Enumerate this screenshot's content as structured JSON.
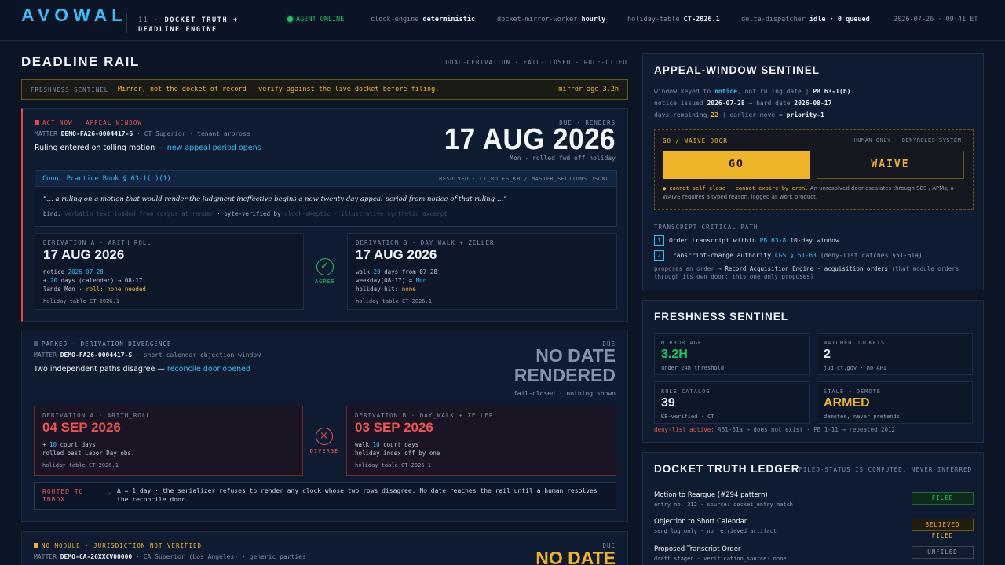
{
  "header": {
    "logo": "AVOWAL",
    "module_num": "11 ·",
    "module_title": "DOCKET TRUTH + DEADLINE ENGINE",
    "agent": "AGENT ONLINE",
    "clock_k": "clock-engine",
    "clock_v": "deterministic",
    "mirror_k": "docket-mirror-worker",
    "mirror_v": "hourly",
    "holiday_k": "holiday-table",
    "holiday_v": "CT-2026.1",
    "delta_k": "delta-dispatcher",
    "delta_v": "idle · 0 queued",
    "timestamp": "2026-07-26 · 09:41 ET"
  },
  "rail": {
    "title": "DEADLINE RAIL",
    "meta": "DUAL-DERIVATION · FAIL-CLOSED · RULE-CITED",
    "freshness": {
      "label": "FRESHNESS SENTINEL",
      "message": "Mirror, not the docket of record — verify against the live docket before filing.",
      "age": "mirror age 3.2h"
    },
    "card1": {
      "tag": "ACT_NOW · APPEAL WINDOW",
      "matter_k": "MATTER",
      "matter_id": "DEMO-FA26-0004417-S",
      "matter_rest": "· CT Superior · tenant arprose",
      "headline": "Ruling entered on tolling motion —",
      "headline_link": "new appeal period opens",
      "due_label": "DUE · RENDERS",
      "date": "17 AUG 2026",
      "date_sub": "Mon · rolled fwd off holiday",
      "cite_title": "Conn. Practice Book § 63-1(c)(1)",
      "cite_resolved": "RESOLVED · CT_RULES_KB / MASTER_SECTIONS.JSONL",
      "quote": "“… a ruling on a motion that would render the judgment ineffective begins a new twenty-day appeal period from notice of that ruling …”",
      "bind_k": "bind:",
      "bind_1": "verbatim text loaded from corpus at render",
      "bind_2": "· byte-verified by",
      "bind_3": "clock-skeptic · illustrative synthetic excerpt",
      "derivA": {
        "label": "DERIVATION A · ARITH_ROLL",
        "date": "17 AUG 2026",
        "l1a": "notice",
        "l1b": "2026-07-28",
        "l2a": "+",
        "l2b": "20",
        "l2c": "days (calendar) → 08-17",
        "l3a": "lands Mon ·",
        "l3b": "roll: none needed",
        "foot": "holiday table CT-2026.1"
      },
      "verdict": "AGREE",
      "derivB": {
        "label": "DERIVATION B · DAY_WALK + ZELLER",
        "date": "17 AUG 2026",
        "l1a": "walk",
        "l1b": "20",
        "l1c": "days from 07-28",
        "l2a": "weekday(08-17) =",
        "l2b": "Mon",
        "l3a": "holiday hit:",
        "l3b": "none",
        "foot": "holiday table CT-2026.1"
      }
    },
    "card2": {
      "tag": "PARKED · DERIVATION DIVERGENCE",
      "matter_k": "MATTER",
      "matter_id": "DEMO-FA26-0004417-S",
      "matter_rest": "· short-calendar objection window",
      "headline": "Two independent paths disagree —",
      "headline_link": "reconcile door opened",
      "due_label": "DUE",
      "date1": "NO DATE",
      "date2": "RENDERED",
      "date_sub": "fail-closed · nothing shown",
      "derivA": {
        "label": "DERIVATION A · ARITH_ROLL",
        "date": "04 SEP 2026",
        "l1a": "+",
        "l1b": "10",
        "l1c": "court days",
        "l2": "rolled past Labor Day obs.",
        "foot": "holiday table CT-2026.1"
      },
      "verdict": "DIVERGE",
      "derivB": {
        "label": "DERIVATION B · DAY_WALK + ZELLER",
        "date": "03 SEP 2026",
        "l1a": "walk",
        "l1b": "10",
        "l1c": "court days",
        "l2": "holiday index off by one",
        "foot": "holiday table CT-2026.1"
      },
      "routed_1": "ROUTED TO",
      "routed_2": "INBOX",
      "routed_text": "Δ = 1 day · the serializer refuses to render any clock whose two rows disagree. No date reaches the rail until a human resolves the reconcile door."
    },
    "card3": {
      "tag": "NO MODULE · JURISDICTION NOT VERIFIED",
      "matter_k": "MATTER",
      "matter_id": "DEMO-CA-26XXCV00000",
      "matter_rest": "· CA Superior (Los Angeles) · generic parties",
      "due_label": "DUE",
      "date": "NO DATE"
    }
  },
  "appeal": {
    "title": "APPEAL-WINDOW SENTINEL",
    "l1a": "window keyed to",
    "l1b": "notice",
    "l1c": ", not ruling date  |  ",
    "l1d": "PB 63-1(b)",
    "l2a": "notice issued",
    "l2b": "2026-07-28",
    "l2c": "→ hard date",
    "l2d": "2026-08-17",
    "l3a": "days remaining",
    "l3b": "22",
    "l3c": "|  earlier-move =",
    "l3d": "priority-1",
    "door_label": "GO / WAIVE DOOR",
    "door_right": "HUMAN-ONLY · DENYROLES(SYSTEM)",
    "go": "GO",
    "waive": "WAIVE",
    "door_note_y": "● cannot self-close · cannot expire by cron.",
    "door_note": "An unresolved door escalates through SES / APMs; a WAIVE requires a typed reason, logged as work product.",
    "tcp_head": "TRANSCRIPT CRITICAL PATH",
    "tcp1_n": "1",
    "tcp1_a": "Order transcript within",
    "tcp1_b": "PB 63-8",
    "tcp1_c": "10-day window",
    "tcp2_n": "2",
    "tcp2_a": "Transcript-charge authority",
    "tcp2_b": "CGS § 51-63",
    "tcp2_c": "(deny-list catches §51-61a)",
    "tcp_note_a": "proposes an order →",
    "tcp_note_b": "Record Acquisition Engine · acquisition_orders",
    "tcp_note_c": "(that module orders through its own door; this one only proposes)"
  },
  "fresh_panel": {
    "title": "FRESHNESS SENTINEL",
    "s1_k": "MIRROR AGE",
    "s1_v": "3.2H",
    "s1_s": "under 24h threshold",
    "s2_k": "WATCHED DOCKETS",
    "s2_v": "2",
    "s2_s": "jud.ct.gov · no API",
    "s3_k": "RULE CATALOG",
    "s3_v": "39",
    "s3_s": "KB-verified · CT",
    "s4_k": "STALE → DEMOTE",
    "s4_v": "ARMED",
    "s4_s": "demotes, never pretends",
    "deny_k": "deny-list active:",
    "deny_v": "§51-61a → does not exist · PB 1-11 → repealed 2012"
  },
  "ledger": {
    "title": "DOCKET TRUTH LEDGER",
    "meta": "FILED-STATUS IS COMPUTED, NEVER INFERRED",
    "rows": [
      {
        "title": "Motion to Reargue (#294 pattern)",
        "meta": "entry no. 312 · source: docket_entry match",
        "status": "FILED"
      },
      {
        "title": "Objection to Short Calendar",
        "meta": "send log only · no retrieved artifact",
        "status": "BELIEVED FILED"
      },
      {
        "title": "Proposed Transcript Order",
        "meta": "draft staged · verification_source: none",
        "status": "UNFILED"
      }
    ]
  }
}
